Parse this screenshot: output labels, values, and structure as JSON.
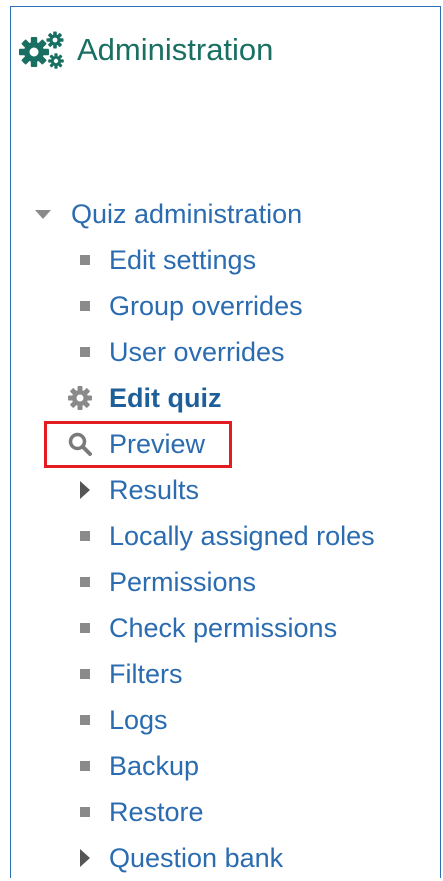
{
  "header": {
    "title": "Administration",
    "icon": "gears-icon"
  },
  "tree": {
    "root": {
      "label": "Quiz administration",
      "icon": "caret-down-icon",
      "expanded": true
    },
    "items": [
      {
        "label": "Edit settings",
        "icon": "bullet"
      },
      {
        "label": "Group overrides",
        "icon": "bullet"
      },
      {
        "label": "User overrides",
        "icon": "bullet"
      },
      {
        "label": "Edit quiz",
        "icon": "gear-icon",
        "bold": true
      },
      {
        "label": "Preview",
        "icon": "search-icon",
        "highlighted": true
      },
      {
        "label": "Results",
        "icon": "caret-right-icon"
      },
      {
        "label": "Locally assigned roles",
        "icon": "bullet"
      },
      {
        "label": "Permissions",
        "icon": "bullet"
      },
      {
        "label": "Check permissions",
        "icon": "bullet"
      },
      {
        "label": "Filters",
        "icon": "bullet"
      },
      {
        "label": "Logs",
        "icon": "bullet"
      },
      {
        "label": "Backup",
        "icon": "bullet"
      },
      {
        "label": "Restore",
        "icon": "bullet"
      },
      {
        "label": "Question bank",
        "icon": "caret-right-icon"
      }
    ]
  },
  "colors": {
    "header_text": "#1a6f63",
    "link_text": "#2b6cb0",
    "bold_link_text": "#1f5f99",
    "highlight_border": "#e31b23",
    "panel_border": "#2d6fb8",
    "icon_gray": "#8a8a8a"
  }
}
